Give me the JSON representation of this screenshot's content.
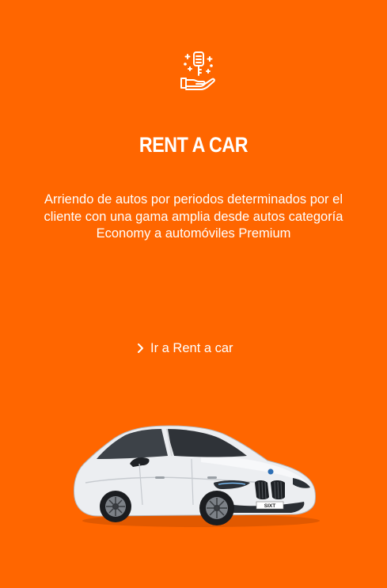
{
  "service": {
    "icon": "car-key-in-hand-icon",
    "title": "RENT A CAR",
    "description": "Arriendo de autos por periodos determinados por el cliente con una gama amplia desde autos categoría Economy a automóviles Premium",
    "link_label": "Ir a Rent a car",
    "link_icon": "chevron-right-icon",
    "car_badge": "SIXT"
  },
  "colors": {
    "background": "#ff6600",
    "text": "#ffffff"
  }
}
